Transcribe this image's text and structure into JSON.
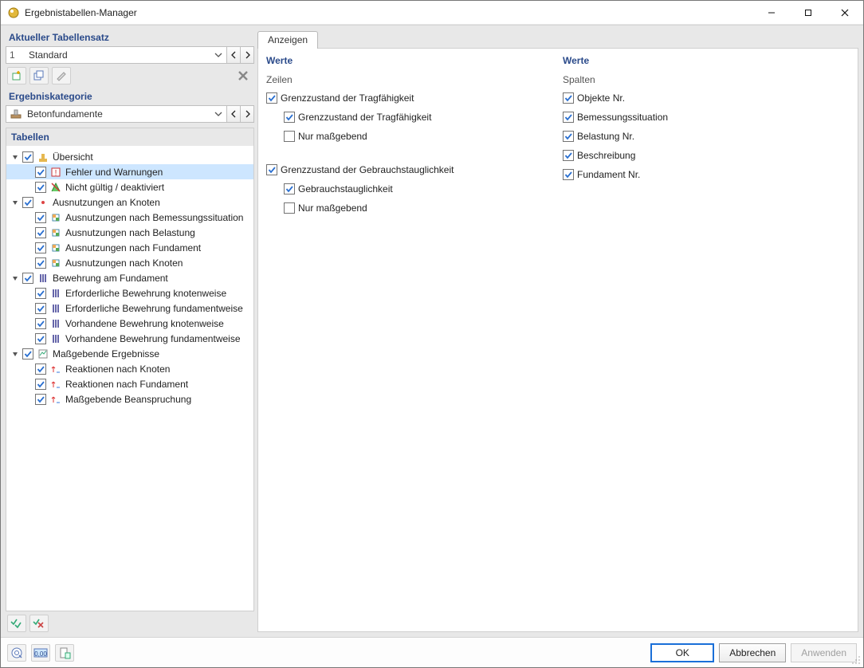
{
  "window": {
    "title": "Ergebnistabellen-Manager"
  },
  "tableset": {
    "heading": "Aktueller Tabellensatz",
    "index": "1",
    "name": "Standard"
  },
  "category": {
    "heading": "Ergebniskategorie",
    "name": "Betonfundamente"
  },
  "tree": {
    "heading": "Tabellen",
    "groups": [
      {
        "label": "Übersicht",
        "children": [
          "Fehler und Warnungen",
          "Nicht gültig / deaktiviert"
        ]
      },
      {
        "label": "Ausnutzungen an Knoten",
        "children": [
          "Ausnutzungen nach Bemessungssituation",
          "Ausnutzungen nach Belastung",
          "Ausnutzungen nach Fundament",
          "Ausnutzungen nach Knoten"
        ]
      },
      {
        "label": "Bewehrung am Fundament",
        "children": [
          "Erforderliche Bewehrung knotenweise",
          "Erforderliche Bewehrung fundamentweise",
          "Vorhandene Bewehrung knotenweise",
          "Vorhandene Bewehrung fundamentweise"
        ]
      },
      {
        "label": "Maßgebende Ergebnisse",
        "children": [
          "Reaktionen nach Knoten",
          "Reaktionen nach Fundament",
          "Maßgebende Beanspruchung"
        ]
      }
    ]
  },
  "tabs": {
    "display": "Anzeigen"
  },
  "values": {
    "heading": "Werte",
    "rows_label": "Zeilen",
    "cols_label": "Spalten",
    "rows": [
      {
        "label": "Grenzzustand der Tragfähigkeit",
        "checked": true,
        "children": [
          {
            "label": "Grenzzustand der Tragfähigkeit",
            "checked": true
          },
          {
            "label": "Nur maßgebend",
            "checked": false
          }
        ]
      },
      {
        "label": "Grenzzustand der Gebrauchstauglichkeit",
        "checked": true,
        "children": [
          {
            "label": "Gebrauchstauglichkeit",
            "checked": true
          },
          {
            "label": "Nur maßgebend",
            "checked": false
          }
        ]
      }
    ],
    "cols": [
      {
        "label": "Objekte Nr.",
        "checked": true
      },
      {
        "label": "Bemessungssituation",
        "checked": true
      },
      {
        "label": "Belastung Nr.",
        "checked": true
      },
      {
        "label": "Beschreibung",
        "checked": true
      },
      {
        "label": "Fundament Nr.",
        "checked": true
      }
    ]
  },
  "buttons": {
    "ok": "OK",
    "cancel": "Abbrechen",
    "apply": "Anwenden"
  }
}
